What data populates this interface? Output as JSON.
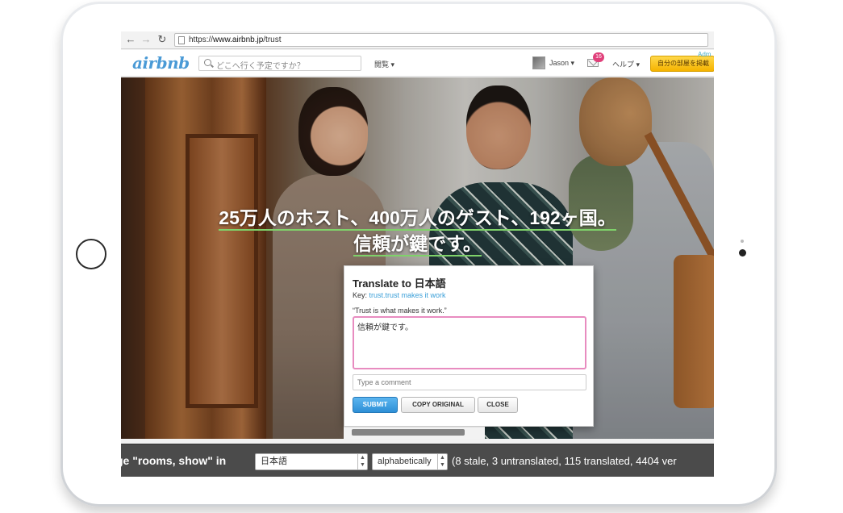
{
  "browser": {
    "back_icon": "arrow-left-icon",
    "forward_icon": "arrow-right-icon",
    "reload_icon": "reload-icon",
    "url_prefix": "https://",
    "url_domain": "www.airbnb.jp",
    "url_path": "/trust"
  },
  "header": {
    "logo": "airbnb",
    "search_placeholder": "どこへ行く予定ですか？",
    "browse_label": "閲覧 ▾",
    "user_name": "Jason ▾",
    "message_count": "16",
    "help_label": "ヘルプ ▾",
    "list_space_label": "自分の部屋を掲載",
    "admin_label": "Adm"
  },
  "hero": {
    "title_line1": "25万人のホスト、400万人のゲスト、192ヶ国。",
    "title_line2": "信頼が鍵です。"
  },
  "dialog": {
    "title": "Translate to 日本語",
    "key_label": "Key:",
    "key_value": "trust.trust makes it work",
    "original_text": "“Trust is what makes it work.”",
    "translation_value": "信頼が鍵です。",
    "comment_placeholder": "Type a comment",
    "submit_label": "SUBMIT",
    "copy_original_label": "COPY ORIGINAL",
    "close_label": "CLOSE"
  },
  "toolbar": {
    "prefix_text": "ge \"rooms, show\" in",
    "language_value": "日本語",
    "sort_value": "alphabetically",
    "stats_text": "(8 stale, 3 untranslated, 115 translated, 4404 ver"
  },
  "colors": {
    "accent_blue": "#3a9fd8",
    "badge_pink": "#e0407a",
    "highlight_green": "#7fd26a",
    "button_yellow": "#f5b300"
  }
}
